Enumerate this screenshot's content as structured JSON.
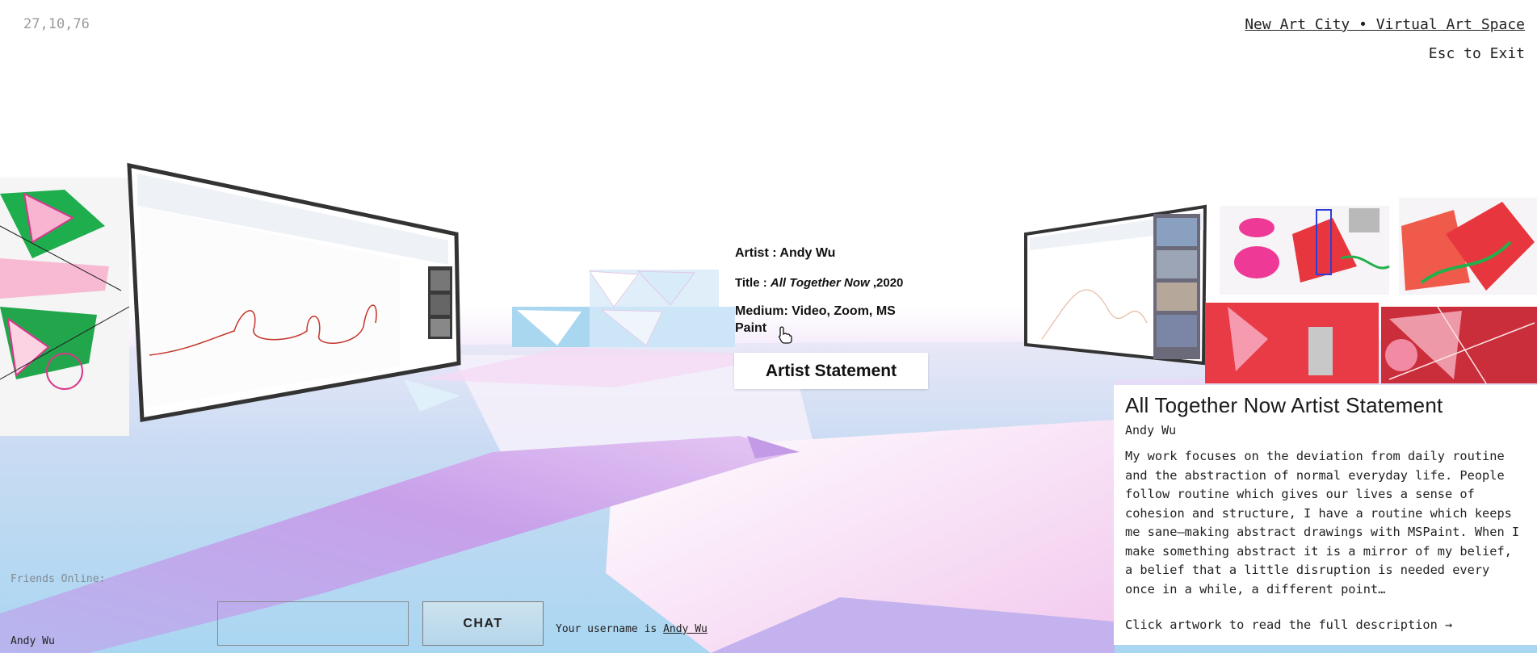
{
  "hud": {
    "coordinates": "27,10,76",
    "site_title": "New Art City • Virtual Art Space",
    "exit_hint": "Esc to Exit"
  },
  "placard": {
    "artist_line": "Artist : Andy Wu",
    "title_prefix": "Title : ",
    "title_italic": "All Together Now",
    "title_suffix": " ,2020",
    "medium_line": "Medium: Video, Zoom, MS Paint",
    "statement_button": "Artist Statement"
  },
  "statement": {
    "title": "All Together Now Artist Statement",
    "author": "Andy Wu",
    "body": "My work focuses on the deviation from daily routine and the abstraction of normal everyday life. People follow routine which gives our lives a sense of cohesion and structure, I have a routine which keeps me sane—making abstract drawings with MSPaint. When I make something abstract it is a mirror of my belief, a belief that a little disruption is needed every once in a while, a different point…",
    "read_more": "Click artwork to read the full description →"
  },
  "chat": {
    "friends_label": "Friends Online:",
    "friends": [
      "Andy Wu"
    ],
    "input_value": "",
    "button_label": "CHAT",
    "username_prefix": "Your username is ",
    "username": "Andy Wu"
  },
  "colors": {
    "floor_blue": "#aed8f0",
    "floor_purple": "#c7a4ea",
    "floor_pink": "#f6d6f2",
    "sky": "#ffffff"
  }
}
